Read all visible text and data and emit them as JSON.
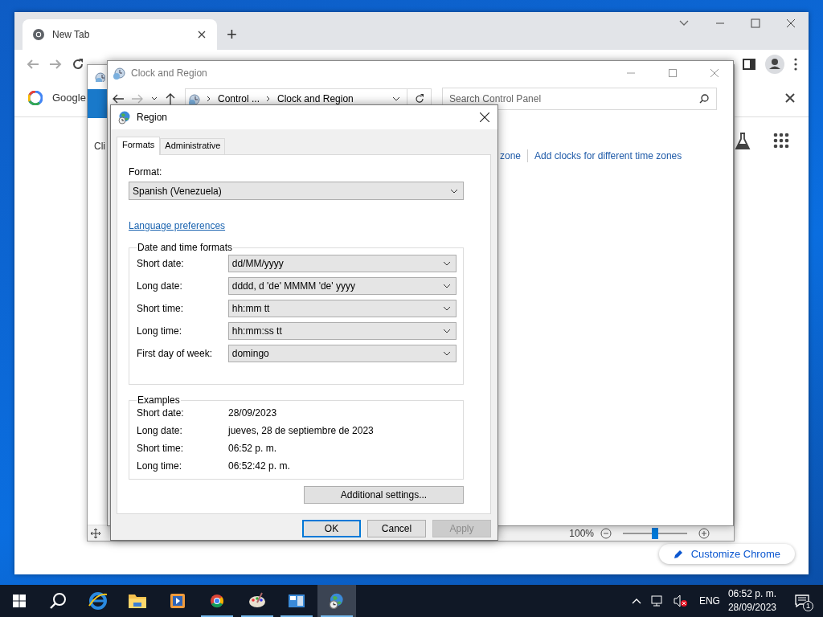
{
  "browser": {
    "tab": {
      "title": "New Tab",
      "selected": true
    },
    "new_tab": "+",
    "bookmark": "Google",
    "customize_button": "Customize Chrome"
  },
  "back_window": {
    "side_text": "Cli",
    "zoom": "100%",
    "zoom_slider": {
      "level": 0.5
    }
  },
  "clock_window": {
    "title": "Clock and Region",
    "breadcrumb": [
      "Control ...",
      "Clock and Region"
    ],
    "search": {
      "placeholder": "Search Control Panel"
    },
    "links": [
      "zone",
      "Add clocks for different time zones"
    ]
  },
  "region_dialog": {
    "title": "Region",
    "tabs": [
      {
        "label": "Formats",
        "selected": true
      },
      {
        "label": "Administrative",
        "selected": false
      }
    ],
    "format_label": "Format:",
    "format_value": "Spanish (Venezuela)",
    "language_link": "Language preferences",
    "formats_group": {
      "title": "Date and time formats",
      "rows": [
        {
          "label": "Short date:",
          "value": "dd/MM/yyyy"
        },
        {
          "label": "Long date:",
          "value": "dddd, d 'de' MMMM 'de' yyyy"
        },
        {
          "label": "Short time:",
          "value": "hh:mm tt"
        },
        {
          "label": "Long time:",
          "value": "hh:mm:ss tt"
        },
        {
          "label": "First day of week:",
          "value": "domingo"
        }
      ]
    },
    "examples_group": {
      "title": "Examples",
      "rows": [
        {
          "label": "Short date:",
          "value": "28/09/2023"
        },
        {
          "label": "Long date:",
          "value": "jueves, 28 de septiembre de 2023"
        },
        {
          "label": "Short time:",
          "value": "06:52 p. m."
        },
        {
          "label": "Long time:",
          "value": "06:52:42 p. m."
        }
      ]
    },
    "additional_button": "Additional settings...",
    "buttons": [
      {
        "label": "OK",
        "default": true,
        "disabled": false
      },
      {
        "label": "Cancel",
        "default": false,
        "disabled": false
      },
      {
        "label": "Apply",
        "default": false,
        "disabled": true
      }
    ]
  },
  "taskbar": {
    "apps": [
      {
        "kind": "ie",
        "running": false,
        "selected": false
      },
      {
        "kind": "folder",
        "running": false,
        "selected": false
      },
      {
        "kind": "media",
        "running": false,
        "selected": false
      },
      {
        "kind": "chrome",
        "running": true,
        "selected": false
      },
      {
        "kind": "paint",
        "running": true,
        "selected": false
      },
      {
        "kind": "control",
        "running": true,
        "selected": false
      },
      {
        "kind": "region",
        "running": true,
        "selected": true
      }
    ],
    "language": "ENG",
    "time": "06:52 p. m.",
    "date": "28/09/2023",
    "notifications": "1"
  }
}
